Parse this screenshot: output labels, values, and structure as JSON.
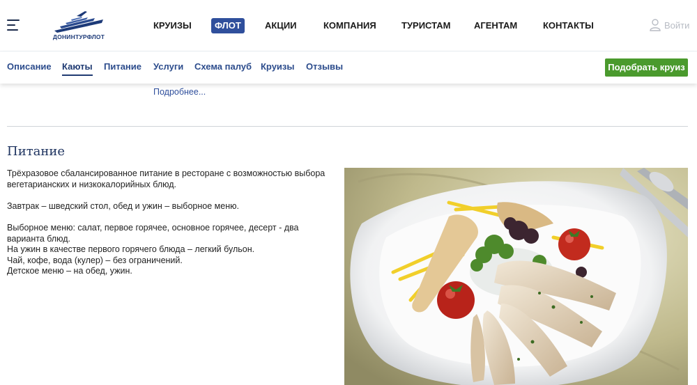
{
  "header": {
    "logo_text": "ДОНИНТУРФЛОТ",
    "nav": [
      {
        "label": "КРУИЗЫ",
        "active": false
      },
      {
        "label": "ФЛОТ",
        "active": true
      },
      {
        "label": "АКЦИИ",
        "active": false
      },
      {
        "label": "КОМПАНИЯ",
        "active": false
      },
      {
        "label": "ТУРИСТАМ",
        "active": false
      },
      {
        "label": "АГЕНТАМ",
        "active": false
      },
      {
        "label": "КОНТАКТЫ",
        "active": false
      }
    ],
    "login_label": "Войти"
  },
  "subnav": {
    "tabs": [
      {
        "label": "Описание"
      },
      {
        "label": "Каюты"
      },
      {
        "label": "Питание"
      },
      {
        "label": "Услуги"
      },
      {
        "label": "Схема палуб"
      },
      {
        "label": "Круизы"
      },
      {
        "label": "Отзывы"
      }
    ],
    "current_tab": "Каюты",
    "pick_button": "Подобрать круиз"
  },
  "content": {
    "more_link": "Подробнее...",
    "section_title": "Питание",
    "paragraphs": [
      "Трёхразовое сбалансированное питание в ресторане с возможностью выбора вегетарианских и низкокалорийных блюд.",
      "Завтрак – шведский стол, обед и ужин – выборное меню.",
      "Выборное меню: салат, первое горячее, основное горячее, десерт - два варианта блюд.",
      "На ужин в качестве первого горячего блюда – легкий бульон.",
      "Чай, кофе, вода (кулер) – без ограничений.",
      "Детское меню – на обед, ужин."
    ]
  },
  "colors": {
    "brand_blue": "#2f4f9c",
    "link_blue": "#2c4c8c",
    "green_button": "#4a9a2d"
  }
}
